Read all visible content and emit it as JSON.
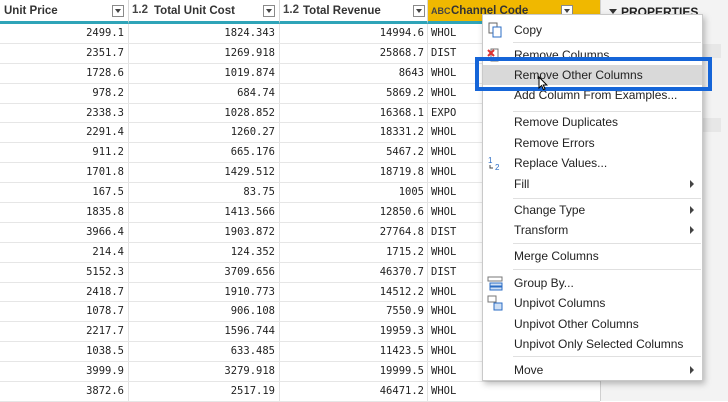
{
  "columns": [
    {
      "type": "",
      "label": "Unit Price"
    },
    {
      "type": "1.2",
      "label": "Total Unit Cost"
    },
    {
      "type": "1.2",
      "label": "Total Revenue"
    },
    {
      "type": "ABC",
      "label": "Channel Code"
    }
  ],
  "rows": [
    [
      "2499.1",
      "1824.343",
      "14994.6",
      "WHOL"
    ],
    [
      "2351.7",
      "1269.918",
      "25868.7",
      "DIST"
    ],
    [
      "1728.6",
      "1019.874",
      "8643",
      "WHOL"
    ],
    [
      "978.2",
      "684.74",
      "5869.2",
      "WHOL"
    ],
    [
      "2338.3",
      "1028.852",
      "16368.1",
      "EXPO"
    ],
    [
      "2291.4",
      "1260.27",
      "18331.2",
      "WHOL"
    ],
    [
      "911.2",
      "665.176",
      "5467.2",
      "WHOL"
    ],
    [
      "1701.8",
      "1429.512",
      "18719.8",
      "WHOL"
    ],
    [
      "167.5",
      "83.75",
      "1005",
      "WHOL"
    ],
    [
      "1835.8",
      "1413.566",
      "12850.6",
      "WHOL"
    ],
    [
      "3966.4",
      "1903.872",
      "27764.8",
      "DIST"
    ],
    [
      "214.4",
      "124.352",
      "1715.2",
      "WHOL"
    ],
    [
      "5152.3",
      "3709.656",
      "46370.7",
      "DIST"
    ],
    [
      "2418.7",
      "1910.773",
      "14512.2",
      "WHOL"
    ],
    [
      "1078.7",
      "906.108",
      "7550.9",
      "WHOL"
    ],
    [
      "2217.7",
      "1596.744",
      "19959.3",
      "WHOL"
    ],
    [
      "1038.5",
      "633.485",
      "11423.5",
      "WHOL"
    ],
    [
      "3999.9",
      "3279.918",
      "19999.5",
      "WHOL"
    ],
    [
      "3872.6",
      "2517.19",
      "46471.2",
      "WHOL"
    ]
  ],
  "context_menu": {
    "items": [
      {
        "label": "Copy",
        "icon": "copy-icon"
      },
      {
        "label": "Remove Columns",
        "icon": "remove-columns-icon"
      },
      {
        "label": "Remove Other Columns",
        "icon": ""
      },
      {
        "label": "Add Column From Examples...",
        "icon": ""
      },
      {
        "label": "Remove Duplicates",
        "icon": ""
      },
      {
        "label": "Remove Errors",
        "icon": ""
      },
      {
        "label": "Replace Values...",
        "icon": "replace-values-icon"
      },
      {
        "label": "Fill",
        "icon": ""
      },
      {
        "label": "Change Type",
        "icon": ""
      },
      {
        "label": "Transform",
        "icon": ""
      },
      {
        "label": "Merge Columns",
        "icon": ""
      },
      {
        "label": "Group By...",
        "icon": "group-by-icon"
      },
      {
        "label": "Unpivot Columns",
        "icon": "unpivot-columns-icon"
      },
      {
        "label": "Unpivot Other Columns",
        "icon": ""
      },
      {
        "label": "Unpivot Only Selected Columns",
        "icon": ""
      },
      {
        "label": "Move",
        "icon": ""
      }
    ]
  },
  "properties_panel": {
    "title": "PROPERTIES"
  },
  "colors": {
    "accent_header": "#f0b800",
    "highlight_border": "#1565d8",
    "column_underline": "#2fa4b8"
  }
}
